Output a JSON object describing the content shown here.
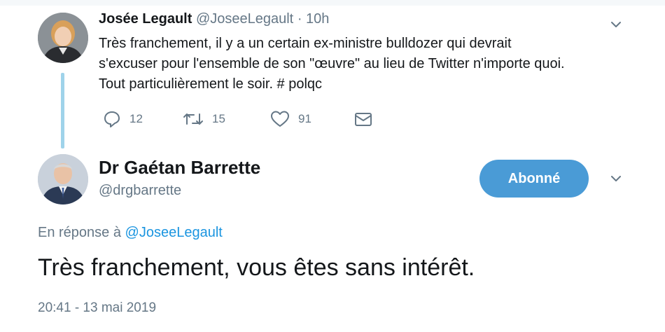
{
  "parent_tweet": {
    "author_name": "Josée Legault",
    "handle": "@JoseeLegault",
    "separator": "·",
    "time": "10h",
    "text_lines": [
      "Très franchement, il y a un certain ex-ministre bulldozer qui devrait",
      "s'excuser pour l'ensemble de son \"œuvre\" au lieu de Twitter n'importe quoi.",
      "Tout particulièrement le soir. # polqc"
    ],
    "counts": {
      "replies": "12",
      "retweets": "15",
      "likes": "91"
    },
    "icons": {
      "reply": "reply-icon",
      "retweet": "retweet-icon",
      "like": "heart-icon",
      "dm": "envelope-icon",
      "menu": "chevron-down-icon"
    }
  },
  "main_tweet": {
    "author_name": "Dr Gaétan Barrette",
    "handle": "@drgbarrette",
    "follow_label": "Abonné",
    "reply_prefix": "En réponse à",
    "reply_handle": "@JoseeLegault",
    "text": "Très franchement, vous êtes sans intérêt.",
    "timestamp": "20:41 - 13 mai 2019"
  },
  "colors": {
    "accent": "#1b95e0",
    "button": "#4a9bd6",
    "thread_line": "#9fd3ea",
    "muted": "#657786"
  }
}
